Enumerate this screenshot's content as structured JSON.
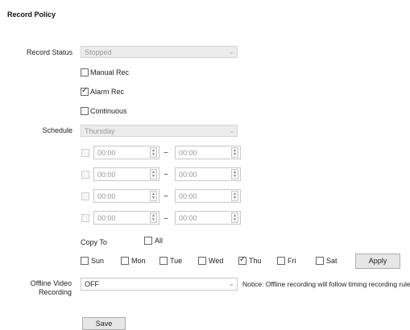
{
  "page_title": "Record Policy",
  "record_status": {
    "label": "Record Status",
    "value": "Stopped"
  },
  "record_types": [
    {
      "label": "Manual Rec",
      "checked": false
    },
    {
      "label": "Alarm Rec",
      "checked": true
    },
    {
      "label": "Continuous",
      "checked": false
    }
  ],
  "schedule": {
    "label": "Schedule",
    "day": "Thursday",
    "periods": [
      {
        "start": "00:00",
        "separator": "~",
        "end": "00:00"
      },
      {
        "start": "00:00",
        "separator": "~",
        "end": "00:00"
      },
      {
        "start": "00:00",
        "separator": "~",
        "end": "00:00"
      },
      {
        "start": "00:00",
        "separator": "~",
        "end": "00:00"
      }
    ]
  },
  "copy_to": {
    "label": "Copy To",
    "all_label": "All",
    "days": [
      {
        "label": "Sun",
        "checked": false
      },
      {
        "label": "Mon",
        "checked": false
      },
      {
        "label": "Tue",
        "checked": false
      },
      {
        "label": "Wed",
        "checked": false
      },
      {
        "label": "Thu",
        "checked": true
      },
      {
        "label": "Fri",
        "checked": false
      },
      {
        "label": "Sat",
        "checked": false
      }
    ],
    "apply_label": "Apply"
  },
  "offline": {
    "label_line1": "Offline Video",
    "label_line2": "Recording",
    "value": "OFF",
    "notice": "Notice: Offline recording will follow timing recording rule."
  },
  "save_label": "Save"
}
